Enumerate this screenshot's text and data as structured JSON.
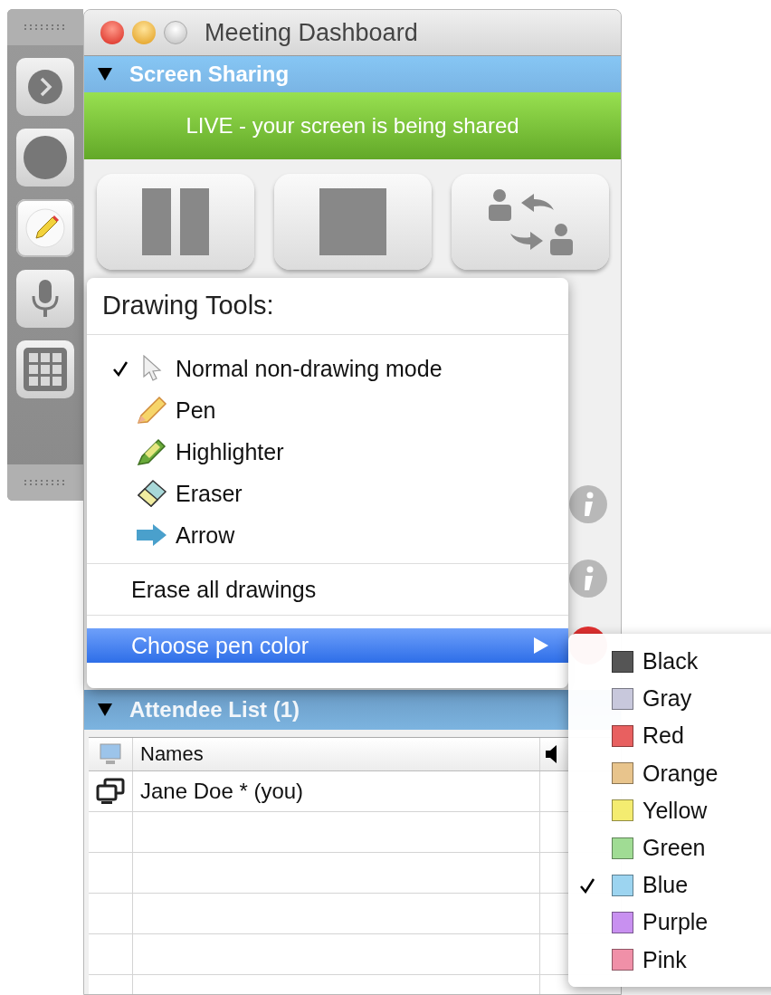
{
  "toolbar": {
    "items": [
      {
        "kind": "forward",
        "selected": false
      },
      {
        "kind": "record",
        "selected": false
      },
      {
        "kind": "pencil",
        "selected": true
      },
      {
        "kind": "microphone",
        "selected": false
      },
      {
        "kind": "grid",
        "selected": false
      }
    ]
  },
  "window": {
    "title": "Meeting Dashboard"
  },
  "screen_sharing": {
    "title": "Screen Sharing",
    "expanded": true,
    "status": "LIVE - your screen is being shared"
  },
  "drawing_menu": {
    "title": "Drawing Tools:",
    "tools": [
      {
        "label": "Normal non-drawing mode",
        "kind": "pointer",
        "checked": true
      },
      {
        "label": "Pen",
        "kind": "pen",
        "checked": false
      },
      {
        "label": "Highlighter",
        "kind": "highlighter",
        "checked": false
      },
      {
        "label": "Eraser",
        "kind": "eraser",
        "checked": false
      },
      {
        "label": "Arrow",
        "kind": "arrow",
        "checked": false
      }
    ],
    "erase_label": "Erase all drawings",
    "color_item": {
      "label": "Choose pen color",
      "highlighted": true
    }
  },
  "color_menu": {
    "items": [
      {
        "label": "Black",
        "color": "#555555",
        "checked": false
      },
      {
        "label": "Gray",
        "color": "#c8c8dc",
        "checked": false
      },
      {
        "label": "Red",
        "color": "#e86060",
        "checked": false
      },
      {
        "label": "Orange",
        "color": "#e8c48c",
        "checked": false
      },
      {
        "label": "Yellow",
        "color": "#f4ec70",
        "checked": false
      },
      {
        "label": "Green",
        "color": "#a0dc94",
        "checked": false
      },
      {
        "label": "Blue",
        "color": "#9cd4f0",
        "checked": true
      },
      {
        "label": "Purple",
        "color": "#c890f0",
        "checked": false
      },
      {
        "label": "Pink",
        "color": "#f090a8",
        "checked": false
      }
    ]
  },
  "attendees": {
    "title": "Attendee List (1)",
    "expanded": true,
    "names_column": "Names",
    "rows": [
      {
        "name": "Jane Doe * (you)"
      }
    ]
  }
}
